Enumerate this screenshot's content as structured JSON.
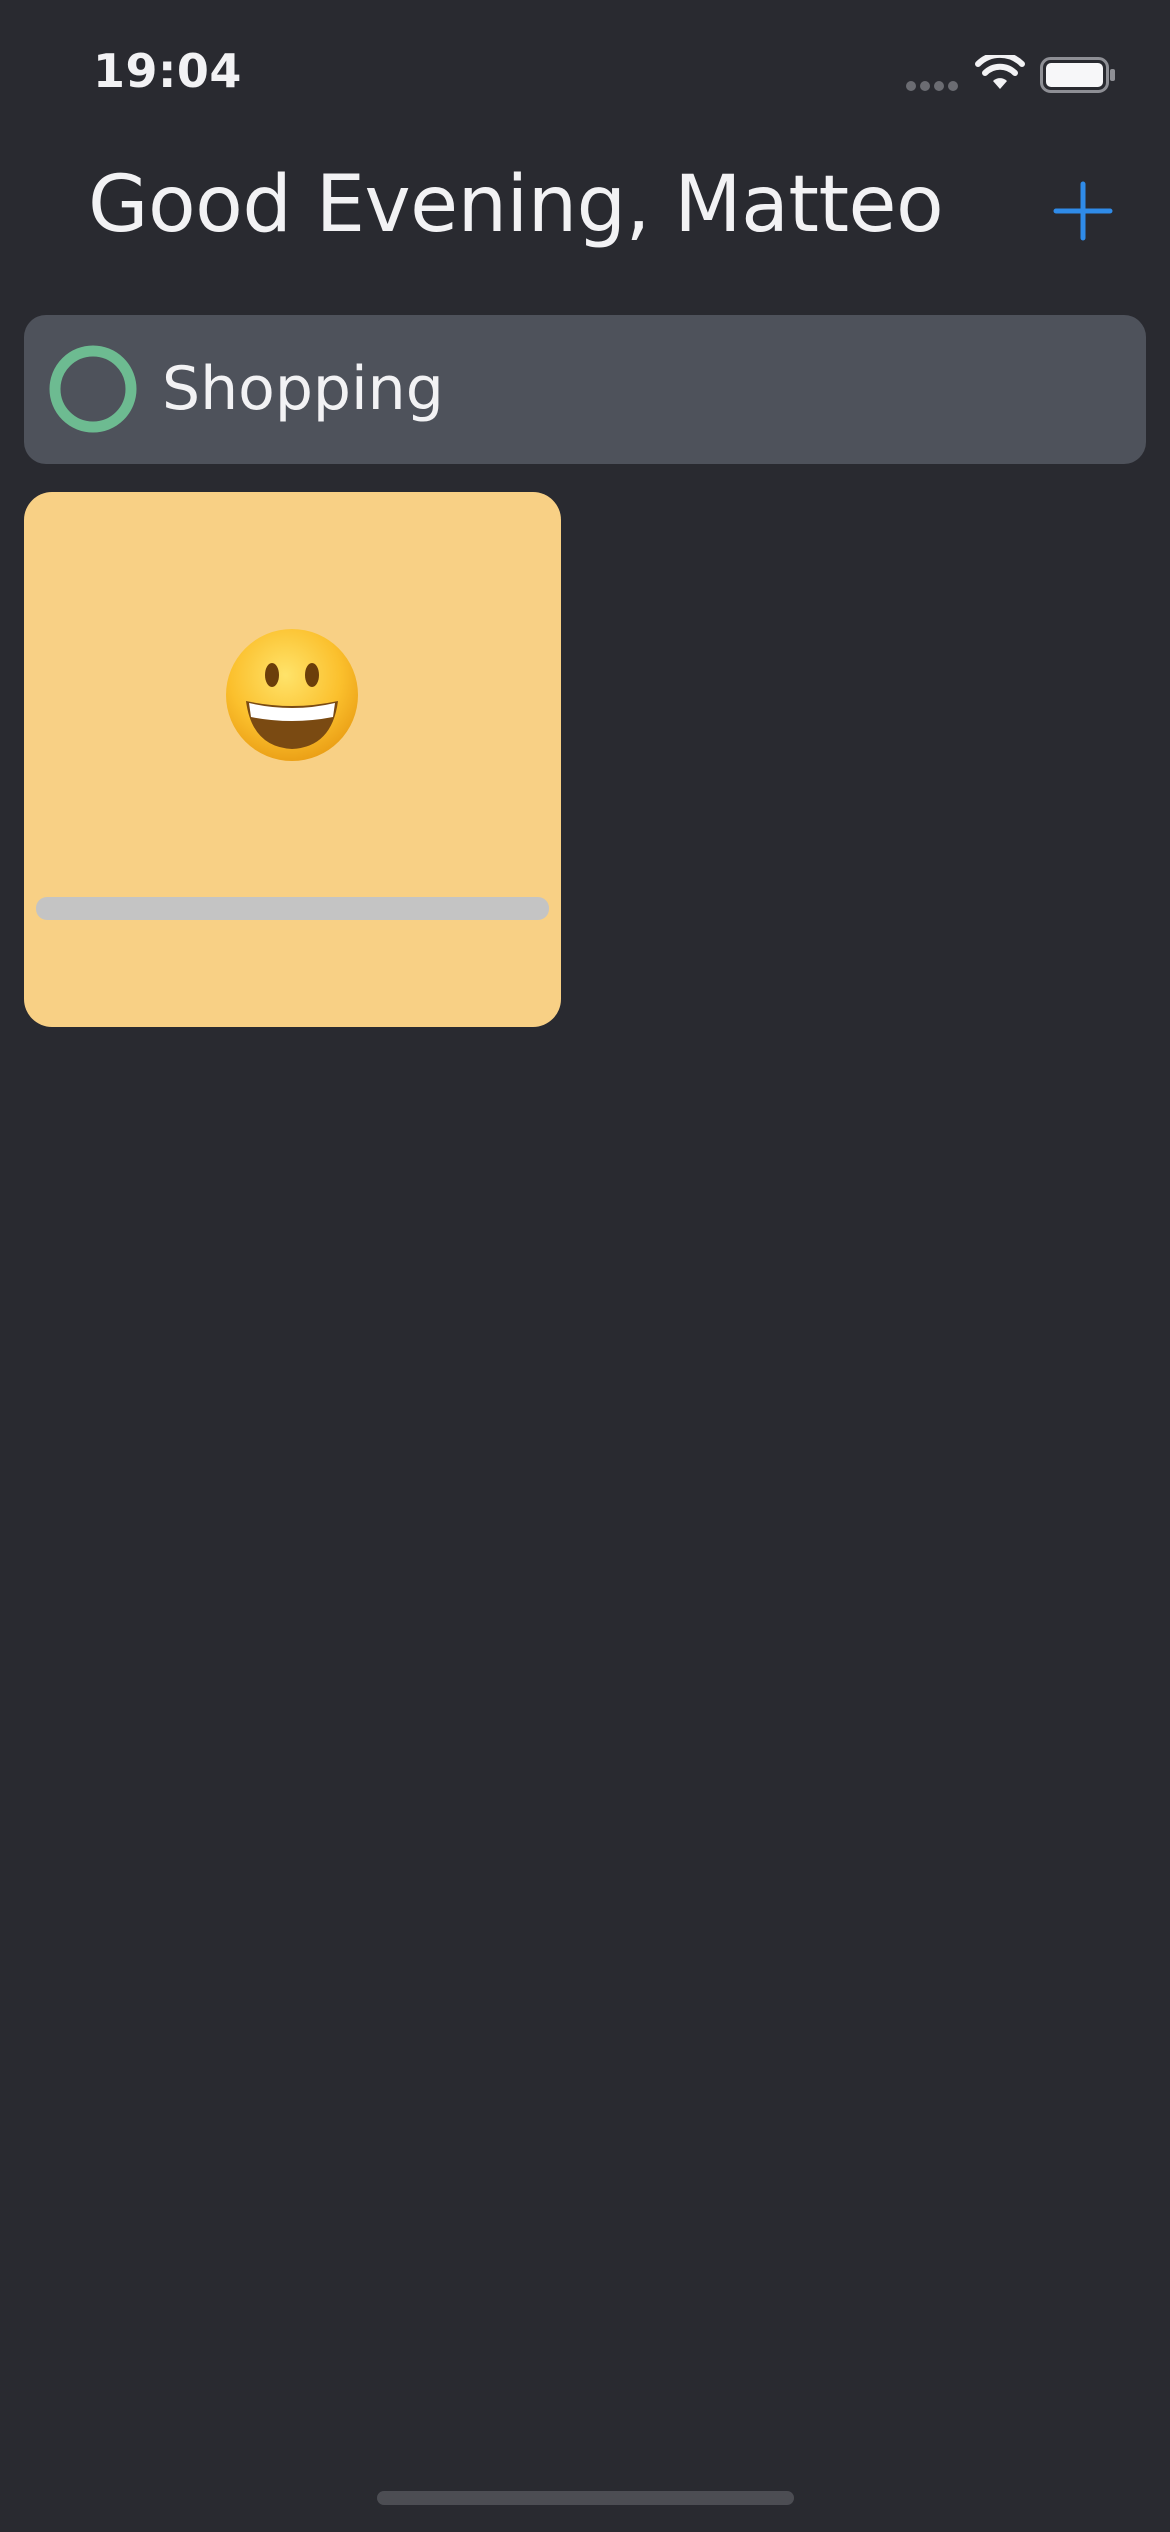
{
  "status_bar": {
    "time": "19:04",
    "icons": [
      "cellular-signal-icon",
      "wifi-icon",
      "battery-icon"
    ]
  },
  "header": {
    "title": "Good Evening, Matteo",
    "add_icon": "plus-icon"
  },
  "lists": [
    {
      "label": "Shopping",
      "icon": "ring-icon"
    }
  ],
  "card": {
    "emoji": "grinning-face",
    "progress": 0
  },
  "colors": {
    "background": "#292a30",
    "row_background": "#4e525b",
    "ring": "#6dbb91",
    "accent": "#2f8be8",
    "card": "#f8d085",
    "progress_track": "#c4c4c4",
    "text": "#f2f2f4"
  }
}
